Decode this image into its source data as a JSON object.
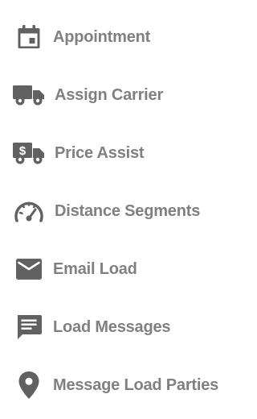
{
  "menu": {
    "items": [
      {
        "label": "Appointment",
        "icon": "calendar-icon"
      },
      {
        "label": "Assign Carrier",
        "icon": "truck-icon"
      },
      {
        "label": "Price Assist",
        "icon": "price-truck-icon"
      },
      {
        "label": "Distance Segments",
        "icon": "speedometer-icon"
      },
      {
        "label": "Email Load",
        "icon": "envelope-icon"
      },
      {
        "label": "Load Messages",
        "icon": "message-icon"
      },
      {
        "label": "Message Load Parties",
        "icon": "location-pin-icon"
      }
    ]
  },
  "colors": {
    "icon": "#616161",
    "text": "#808080",
    "background": "#ffffff"
  }
}
